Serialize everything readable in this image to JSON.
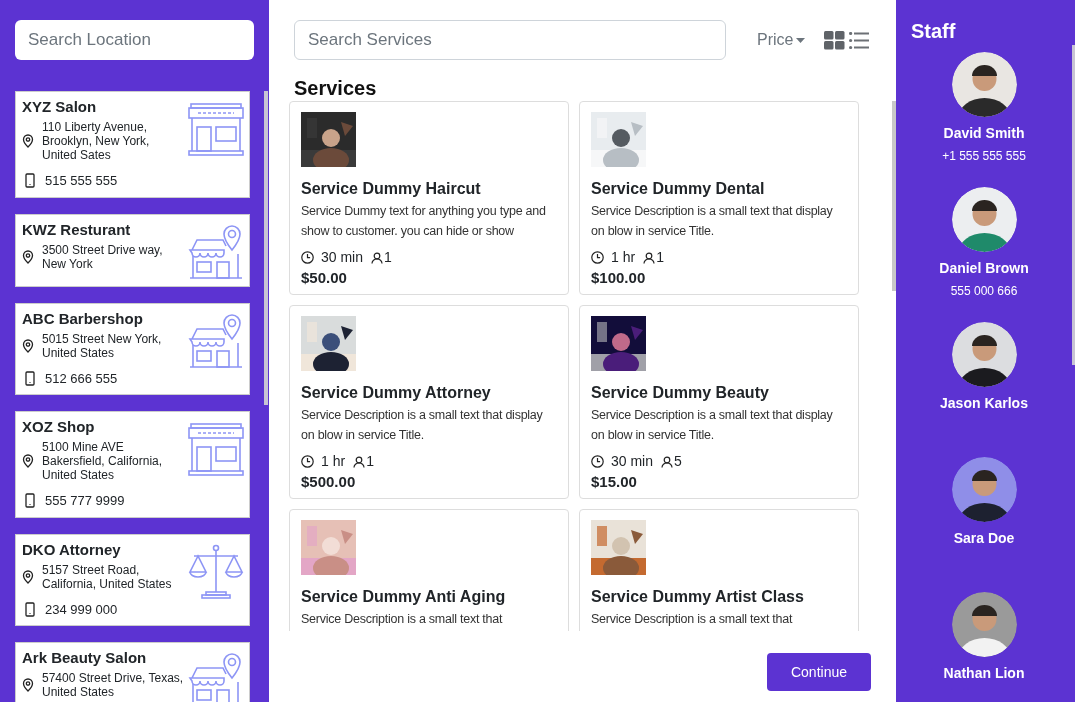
{
  "locations": {
    "search": {
      "placeholder": "Search Location"
    },
    "items": [
      {
        "name": "XYZ Salon",
        "address": "110 Liberty Avenue, Brooklyn, New York, United Sates",
        "phone": "515 555 555",
        "kind": "salon"
      },
      {
        "name": "KWZ Resturant",
        "address": "3500 Street Drive way, New York",
        "kind": "shop"
      },
      {
        "name": "ABC Barbershop",
        "address": "5015 Street New York, United States",
        "phone": "512 666 555",
        "kind": "shop"
      },
      {
        "name": "XOZ Shop",
        "address": "5100 Mine AVE Bakersfield, California, United States",
        "phone": "555 777 9999",
        "kind": "salon"
      },
      {
        "name": "DKO Attorney",
        "address": "5157 Street Road, California, United States",
        "phone": "234 999 000",
        "kind": "scales"
      },
      {
        "name": "Ark Beauty Salon",
        "address": "57400 Street Drive, Texas, United States",
        "kind": "shop"
      }
    ]
  },
  "services": {
    "search": {
      "placeholder": "Search Services"
    },
    "sort": "Price",
    "title": "Services",
    "items": [
      {
        "name": "Service Dummy Haircut",
        "description": "Service Dummy text for anything you type and show to customer. you can hide or show",
        "duration": "30 min",
        "staff": "1",
        "price": "$50.00",
        "kind": "picture"
      },
      {
        "name": "Service Dummy Dental",
        "description": "Service Description is a small text that display on blow in service Title.",
        "duration": "1 hr",
        "staff": "1",
        "price": "$100.00",
        "kind": "picture"
      },
      {
        "name": "Service Dummy Attorney",
        "description": "Service Description is a small text that display on blow in service Title.",
        "duration": "1 hr",
        "staff": "1",
        "price": "$500.00",
        "kind": "picture"
      },
      {
        "name": "Service Dummy Beauty",
        "description": "Service Description is a small text that display on blow in service Title.",
        "duration": "30 min",
        "staff": "5",
        "price": "$15.00",
        "kind": "picture"
      },
      {
        "name": "Service Dummy Anti Aging",
        "description": "Service Description is a small text that",
        "kind": "picture"
      },
      {
        "name": "Service Dummy Artist Class",
        "description": "Service Description is a small text that",
        "kind": "picture"
      }
    ],
    "continue": "Continue"
  },
  "staff": {
    "title": "Staff",
    "members": [
      {
        "name": "David Smith",
        "phone": "+1 555 555 555"
      },
      {
        "name": "Daniel Brown",
        "phone": "555 000 666"
      },
      {
        "name": "Jason Karlos"
      },
      {
        "name": "Sara Doe"
      },
      {
        "name": "Nathan Lion"
      }
    ]
  }
}
